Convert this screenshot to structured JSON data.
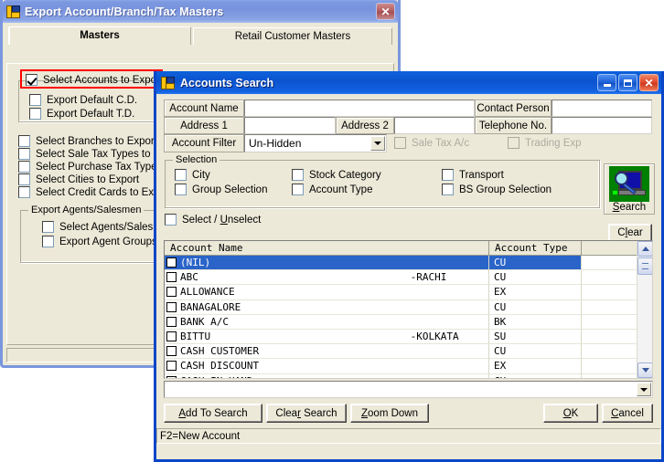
{
  "background_window": {
    "title": "Export Account/Branch/Tax Masters",
    "close_label": "✕",
    "tabs": [
      {
        "label": "Masters",
        "selected": true
      },
      {
        "label": "Retail Customer Masters",
        "selected": false
      }
    ],
    "highlighted_option": "Select Accounts to Export",
    "options_group_a": [
      "Export Default C.D.",
      "Export Default T.D."
    ],
    "options_main": [
      "Select Branches to Export",
      "Select Sale Tax Types to Exp",
      "Select Purchase Tax Types t",
      "Select Cities to Export",
      "Select Credit Cards to Export"
    ],
    "agents_group": {
      "legend": "Export Agents/Salesmen",
      "items": [
        "Select Agents/Salesmen",
        "Export Agent Groups als"
      ]
    },
    "highlight_color": "#ff0000",
    "titlebar_color": "#7b98e0"
  },
  "dialog": {
    "title": "Accounts Search",
    "titlebar_color": "#0b53cf",
    "minimize_label": "",
    "maximize_label": "",
    "close_label": "✕",
    "fields": {
      "account_name": {
        "label": "Account Name",
        "value": ""
      },
      "contact_person": {
        "label": "Contact Person",
        "value": ""
      },
      "address1": {
        "label": "Address 1",
        "value": ""
      },
      "address2": {
        "label": "Address 2",
        "value": ""
      },
      "telephone_no": {
        "label": "Telephone No.",
        "value": ""
      },
      "account_filter": {
        "label": "Account Filter",
        "value": "Un-Hidden"
      }
    },
    "disabled_checks": [
      {
        "label": "Sale Tax A/c",
        "checked": false
      },
      {
        "label": "Trading Exp",
        "checked": false
      }
    ],
    "selection_group": {
      "legend": "Selection",
      "items": [
        {
          "label": "City",
          "checked": false
        },
        {
          "label": "Stock Category",
          "checked": false
        },
        {
          "label": "Transport",
          "checked": false
        },
        {
          "label": "Group Selection",
          "checked": false
        },
        {
          "label": "Account Type",
          "checked": false
        },
        {
          "label": "BS Group Selection",
          "checked": false
        }
      ]
    },
    "select_unselect": {
      "label_pre": "Select / ",
      "label_key": "U",
      "label_post": "nselect",
      "checked": false
    },
    "search_button": {
      "label_pre": "",
      "label_key": "S",
      "label_post": "earch",
      "icon": "search-computer-icon"
    },
    "clear_button": {
      "label_pre": "C",
      "label_key": "l",
      "label_post": "ear"
    },
    "grid": {
      "columns": [
        "Account Name",
        "Account Type",
        ""
      ],
      "rows": [
        {
          "name": "(NIL)",
          "suffix": "",
          "type": "CU",
          "checked": false,
          "selected": true
        },
        {
          "name": "ABC",
          "suffix": "-RACHI",
          "type": "CU",
          "checked": false,
          "selected": false
        },
        {
          "name": "ALLOWANCE",
          "suffix": "",
          "type": "EX",
          "checked": false,
          "selected": false
        },
        {
          "name": "BANAGALORE",
          "suffix": "",
          "type": "CU",
          "checked": false,
          "selected": false
        },
        {
          "name": "BANK A/C",
          "suffix": "",
          "type": "BK",
          "checked": false,
          "selected": false
        },
        {
          "name": "BITTU",
          "suffix": "-KOLKATA",
          "type": "SU",
          "checked": false,
          "selected": false
        },
        {
          "name": "CASH CUSTOMER",
          "suffix": "",
          "type": "CU",
          "checked": false,
          "selected": false
        },
        {
          "name": "CASH DISCOUNT",
          "suffix": "",
          "type": "EX",
          "checked": false,
          "selected": false
        },
        {
          "name": "CASH IN HAND",
          "suffix": "",
          "type": "CH",
          "checked": false,
          "selected": false
        }
      ]
    },
    "bottom_combo": {
      "value": ""
    },
    "buttons": [
      {
        "pre": "",
        "key": "A",
        "post": "dd To Search",
        "name": "add-to-search-button"
      },
      {
        "pre": "Clea",
        "key": "r",
        "post": " Search",
        "name": "clear-search-button"
      },
      {
        "pre": "",
        "key": "Z",
        "post": "oom  Down",
        "name": "zoom-down-button"
      },
      {
        "pre": "",
        "key": "O",
        "post": "K",
        "name": "ok-button"
      },
      {
        "pre": "",
        "key": "C",
        "post": "ancel",
        "name": "cancel-button"
      }
    ],
    "status_bar": "F2=New Account"
  }
}
